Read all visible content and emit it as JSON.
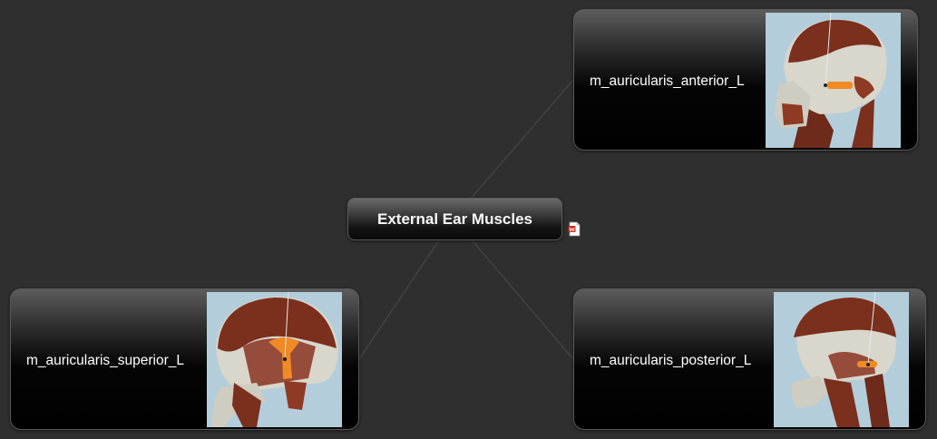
{
  "central_topic": {
    "label": "External Ear Muscles",
    "attachment_icon": "document-attachment-icon"
  },
  "subtopics": [
    {
      "id": "anterior",
      "label": "m_auricularis_anterior_L",
      "image": "skull-anterior-muscle-thumbnail"
    },
    {
      "id": "superior",
      "label": "m_auricularis_superior_L",
      "image": "skull-superior-muscle-thumbnail"
    },
    {
      "id": "posterior",
      "label": "m_auricularis_posterior_L",
      "image": "skull-posterior-muscle-thumbnail"
    }
  ],
  "colors": {
    "background": "#2f2f2f",
    "node_text": "#ffffff",
    "connector": "#4a4a4a",
    "highlight_muscle": "#f08a24",
    "muscle": "#7b2f1d",
    "bone": "#d9d6cc",
    "thumb_bg": "#b3ceda"
  }
}
